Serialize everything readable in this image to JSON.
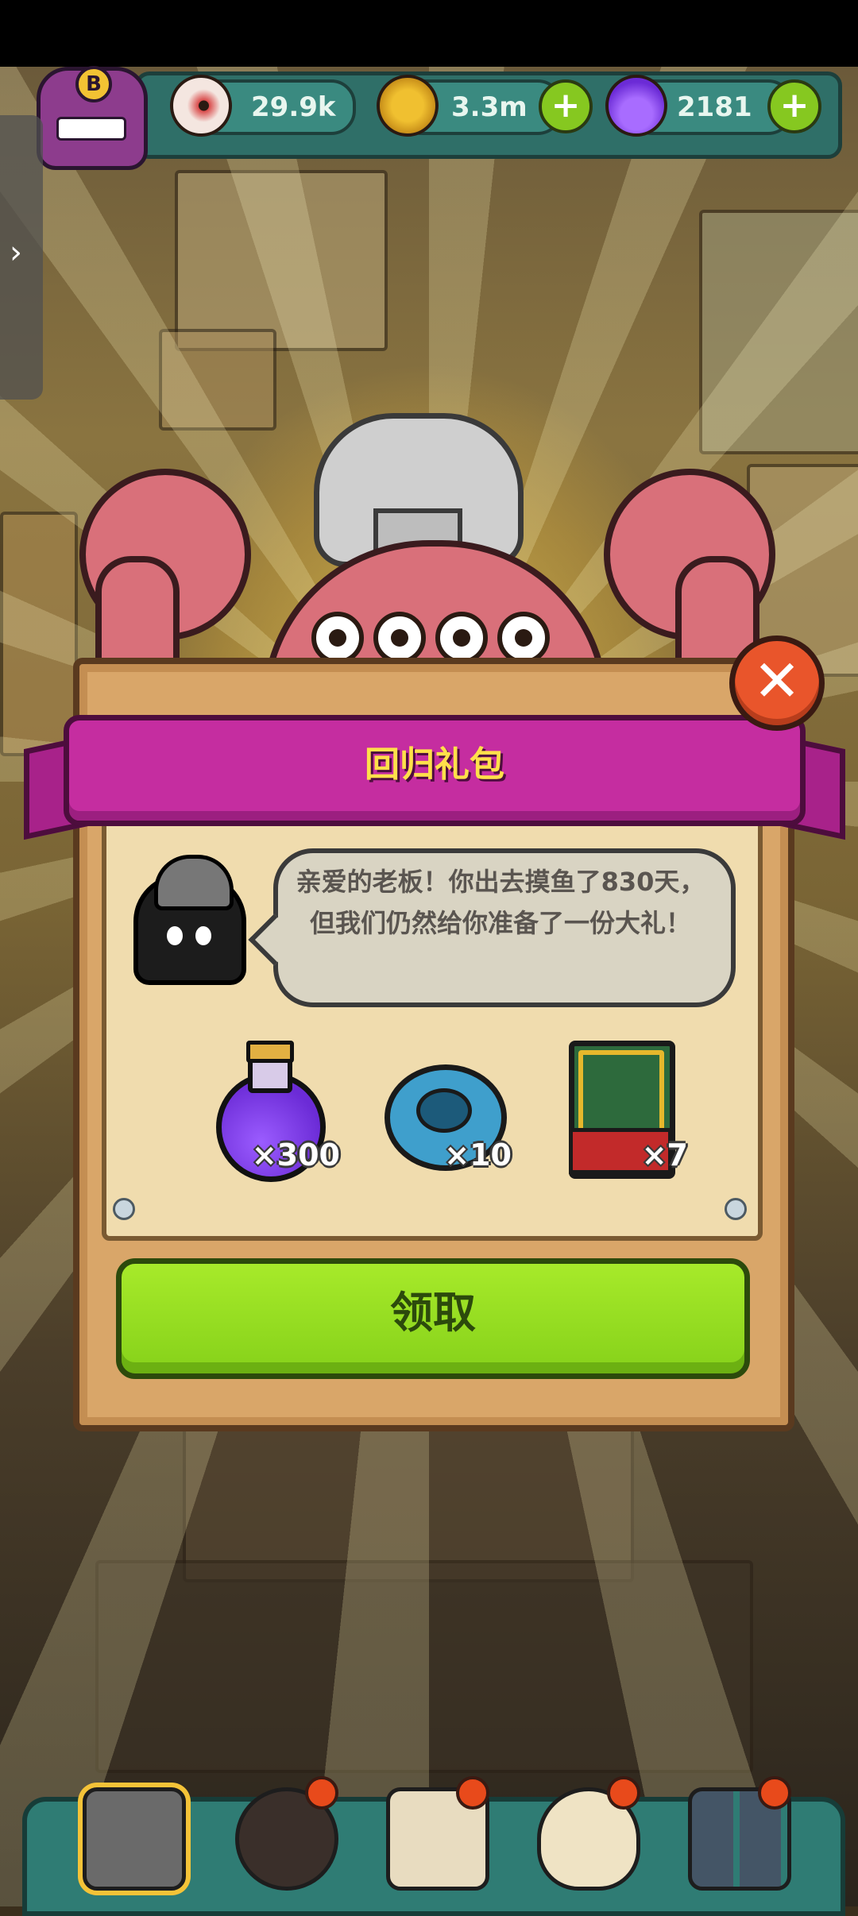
{
  "top_bar": {
    "avatar_badge": "B",
    "eyeball_count": "29.9k",
    "coin_count": "3.3m",
    "potion_count": "2181",
    "plus_label": "+"
  },
  "side_handle": {
    "arrow": "›"
  },
  "popup": {
    "title": "回归礼包",
    "close_label": "✕",
    "message": "亲爱的老板！你出去摸鱼了830天，但我们仍然给你准备了一份大礼！",
    "rewards": [
      {
        "name": "potion",
        "quantity": "×300"
      },
      {
        "name": "cog-machine",
        "quantity": "×10"
      },
      {
        "name": "monster-card",
        "quantity": "×7"
      }
    ],
    "claim_label": "领取"
  },
  "colors": {
    "banner": "#c52da0",
    "title_text": "#ffe04a",
    "claim_button": "#86d11a",
    "close_button": "#e9552b",
    "nav_bar": "#2f7c74"
  },
  "bottom_nav": [
    {
      "name": "shop",
      "selected": true
    },
    {
      "name": "monsters",
      "selected": false,
      "badge": true
    },
    {
      "name": "book",
      "selected": false,
      "badge": true
    },
    {
      "name": "bag",
      "selected": false,
      "badge": true
    },
    {
      "name": "grid-menu",
      "selected": false,
      "badge": true
    }
  ]
}
